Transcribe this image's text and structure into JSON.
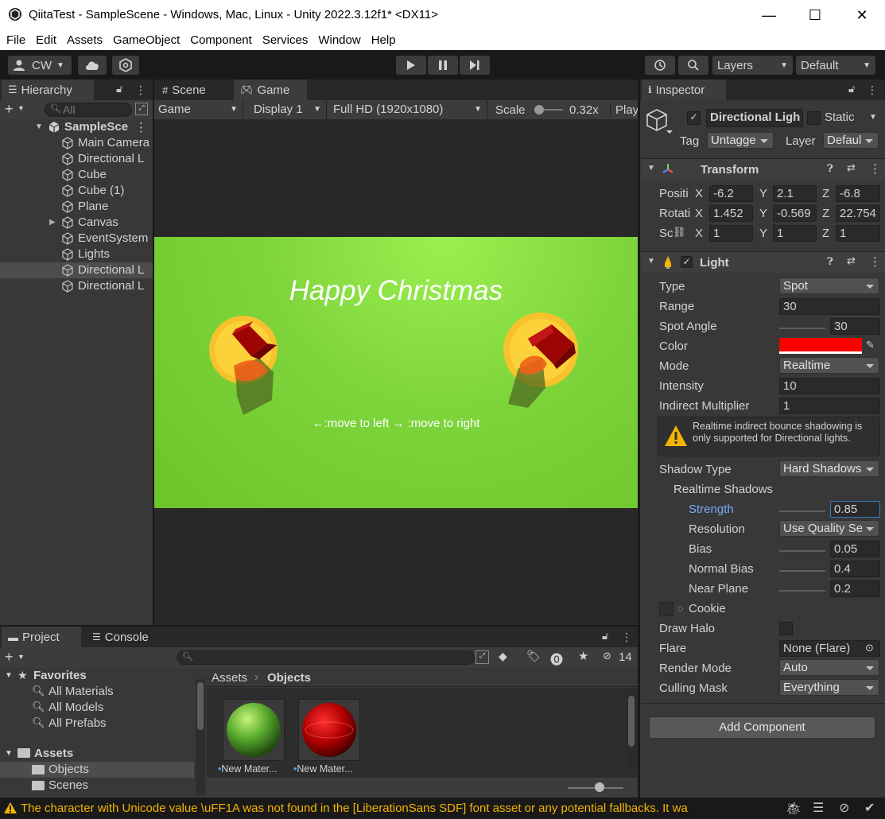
{
  "window": {
    "title": "QiitaTest - SampleScene - Windows, Mac, Linux - Unity 2022.3.12f1* <DX11>",
    "minimize": "—",
    "maximize": "☐",
    "close": "✕"
  },
  "menu": [
    "File",
    "Edit",
    "Assets",
    "GameObject",
    "Component",
    "Services",
    "Window",
    "Help"
  ],
  "toolbar": {
    "account": "CW",
    "layers": "Layers",
    "layout": "Default"
  },
  "hierarchy": {
    "tab": "Hierarchy",
    "search_placeholder": "All",
    "scene": "SampleSce",
    "items": [
      {
        "label": "Main Camera"
      },
      {
        "label": "Directional L"
      },
      {
        "label": "Cube"
      },
      {
        "label": "Cube (1)"
      },
      {
        "label": "Plane"
      },
      {
        "label": "Canvas"
      },
      {
        "label": "EventSystem"
      },
      {
        "label": "Lights"
      },
      {
        "label": "Directional L"
      },
      {
        "label": "Directional L"
      }
    ]
  },
  "view": {
    "tab_scene": "Scene",
    "tab_game": "Game",
    "game_mode": "Game",
    "display": "Display 1",
    "resolution": "Full HD (1920x1080)",
    "scale_label": "Scale",
    "scale_value": "0.32x",
    "play_label": "Play",
    "game_text_title": "Happy Christmas",
    "game_text_controls": "←:move to left   → :move to right"
  },
  "inspector": {
    "tab": "Inspector",
    "object_name": "Directional Ligh",
    "static_label": "Static",
    "tag_label": "Tag",
    "tag_value": "Untagge",
    "layer_label": "Layer",
    "layer_value": "Defaul",
    "transform": {
      "title": "Transform",
      "position_label": "Positi",
      "rotation_label": "Rotati",
      "scale_label": "Sc",
      "pos": {
        "x": "-6.2",
        "y": "2.1",
        "z": "-6.8"
      },
      "rot": {
        "x": "1.452",
        "y": "-0.569",
        "z": "22.754"
      },
      "scl": {
        "x": "1",
        "y": "1",
        "z": "1"
      }
    },
    "light": {
      "title": "Light",
      "type_label": "Type",
      "type_value": "Spot",
      "range_label": "Range",
      "range_value": "30",
      "spot_label": "Spot Angle",
      "spot_value": "30",
      "color_label": "Color",
      "color_value": "#ff0000",
      "mode_label": "Mode",
      "mode_value": "Realtime",
      "intensity_label": "Intensity",
      "intensity_value": "10",
      "indirect_label": "Indirect Multiplier",
      "indirect_value": "1",
      "warning": "Realtime indirect bounce shadowing is only supported for Directional lights.",
      "shadow_type_label": "Shadow Type",
      "shadow_type_value": "Hard Shadows",
      "realtime_shadows_label": "Realtime Shadows",
      "strength_label": "Strength",
      "strength_value": "0.85",
      "resolution_label": "Resolution",
      "resolution_value": "Use Quality Se",
      "bias_label": "Bias",
      "bias_value": "0.05",
      "normal_bias_label": "Normal Bias",
      "normal_bias_value": "0.4",
      "near_plane_label": "Near Plane",
      "near_plane_value": "0.2",
      "cookie_label": "Cookie",
      "halo_label": "Draw Halo",
      "flare_label": "Flare",
      "flare_value": "None (Flare)",
      "render_mode_label": "Render Mode",
      "render_mode_value": "Auto",
      "culling_label": "Culling Mask",
      "culling_value": "Everything"
    },
    "add_component": "Add Component"
  },
  "project": {
    "tab_project": "Project",
    "tab_console": "Console",
    "hidden_count": "14",
    "favorites_label": "Favorites",
    "favorites": [
      "All Materials",
      "All Models",
      "All Prefabs"
    ],
    "assets_label": "Assets",
    "folders": [
      "Objects",
      "Scenes"
    ],
    "breadcrumb_root": "Assets",
    "breadcrumb_current": "Objects",
    "materials": [
      {
        "name": "New Mater..."
      },
      {
        "name": "New Mater..."
      }
    ]
  },
  "status": {
    "message": "The character with Unicode value \\uFF1A was not found in the [LiberationSans SDF] font asset or any potential fallbacks. It wa"
  },
  "colors": {
    "accent_selected": "#2c5d87",
    "warning": "#f4b400",
    "light_color": "#ff0000",
    "game_bg": "#7ed43b"
  }
}
